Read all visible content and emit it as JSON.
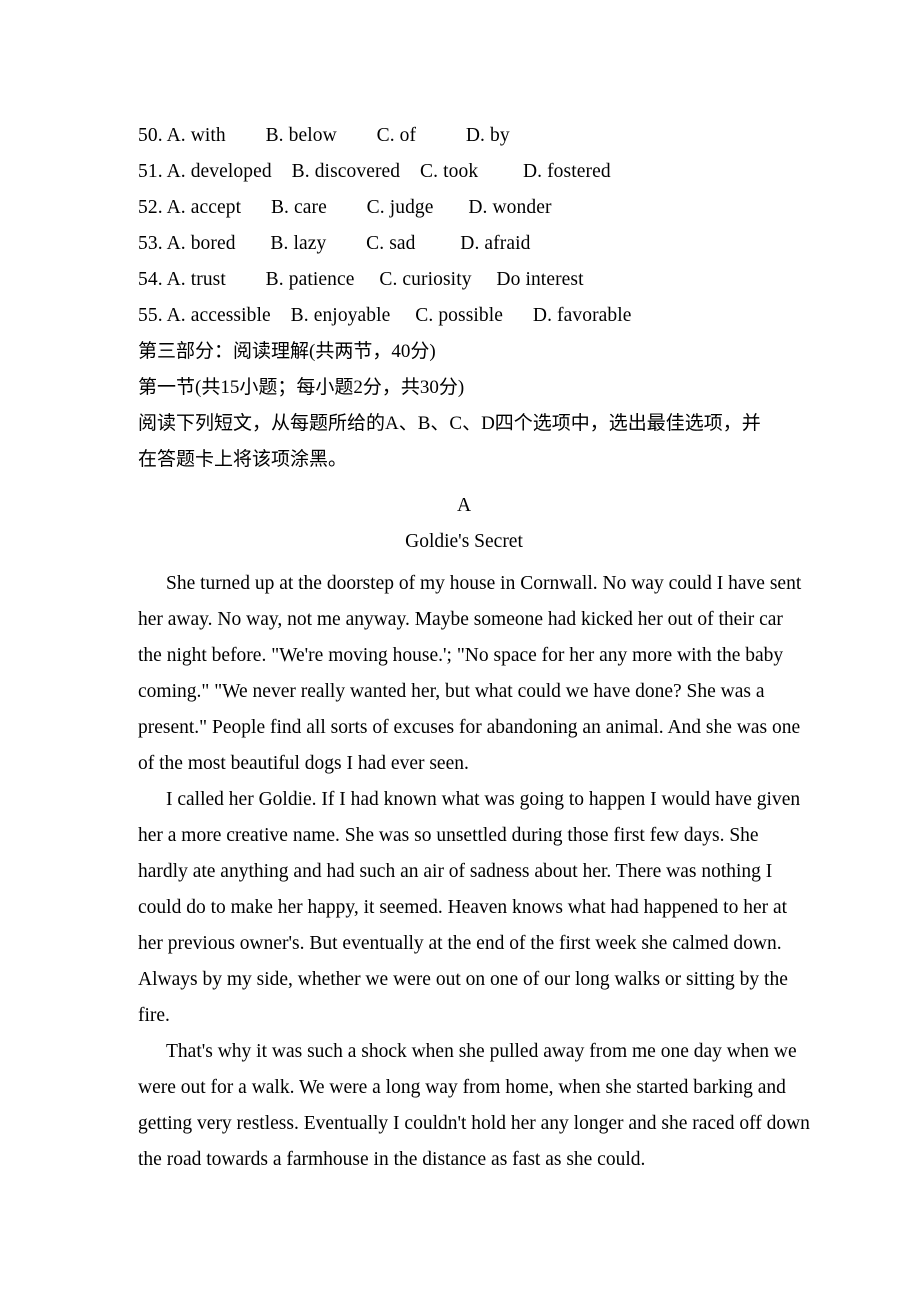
{
  "document": {
    "cloze_options": [
      {
        "number": "50.",
        "text": "50. A. with        B. below        C. of          D. by"
      },
      {
        "number": "51.",
        "text": "51. A. developed    B. discovered    C. took         D. fostered"
      },
      {
        "number": "52.",
        "text": "52. A. accept      B. care        C. judge       D. wonder"
      },
      {
        "number": "53.",
        "text": "53. A. bored       B. lazy        C. sad         D. afraid"
      },
      {
        "number": "54.",
        "text": "54. A. trust        B. patience     C. curiosity     Do interest"
      },
      {
        "number": "55.",
        "text": "55. A. accessible    B. enjoyable     C. possible      D. favorable"
      }
    ],
    "section_heading": "第三部分：阅读理解(共两节，40分)",
    "subsection_heading": "第一节(共15小题；每小题2分，共30分)",
    "instruction_line_1": "阅读下列短文，从每题所给的A、B、C、D四个选项中，选出最佳选项，并",
    "instruction_line_2": "在答题卡上将该项涂黑。",
    "passage_label": "A",
    "passage_title": "Goldie's Secret",
    "paragraphs": [
      {
        "id": "p1",
        "lines": [
          "She turned up at the doorstep of my house in Cornwall. No way could I have sent",
          "her away. No way, not me anyway. Maybe someone had kicked her out of their car",
          "the night before. \"We're moving house.'; \"No space for her any more with the baby",
          "coming.\" \"We never really wanted her, but what could we have done? She was a",
          "present.\" People find all sorts of excuses for abandoning an animal. And she was one",
          "of the most beautiful dogs I had ever seen."
        ]
      },
      {
        "id": "p2",
        "lines": [
          "I called her Goldie. If I had known what was going to happen I would have given",
          "her a more creative name. She was so unsettled during those first few days. She",
          "hardly ate anything and had such an air of sadness about her. There was nothing I",
          "could do to make her happy, it seemed. Heaven knows what had happened to her at",
          "her previous owner's. But eventually at the end of the first week she calmed down.",
          "Always by my side, whether we were out on one of our long walks or sitting by the",
          "fire."
        ]
      },
      {
        "id": "p3",
        "lines": [
          "That's why it was such a shock when she pulled away from me one day when we",
          "were out for a walk. We were a long way from home, when she started barking and",
          "getting very restless. Eventually I couldn't hold her any longer and she raced off down",
          "the road towards a farmhouse in the distance as fast as she could."
        ]
      }
    ]
  }
}
